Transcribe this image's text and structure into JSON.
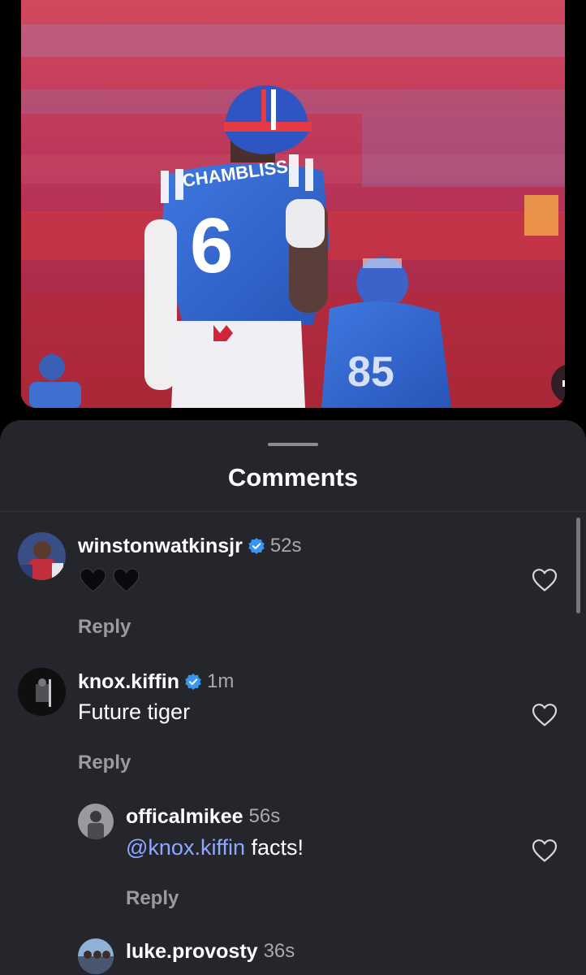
{
  "video": {
    "jersey_name": "CHAMBLISS",
    "jersey_number": "6",
    "second_player_number": "85",
    "sound_icon": "speaker-icon"
  },
  "sheet": {
    "title": "Comments"
  },
  "comments": [
    {
      "username": "winstonwatkinsjr",
      "verified": true,
      "time": "52s",
      "text": "",
      "emoji": [
        "black-heart",
        "black-heart"
      ],
      "reply_label": "Reply"
    },
    {
      "username": "knox.kiffin",
      "verified": true,
      "time": "1m",
      "text": "Future tiger",
      "reply_label": "Reply"
    },
    {
      "username": "officalmikee",
      "verified": false,
      "time": "56s",
      "mention": "@knox.kiffin",
      "text": " facts!",
      "reply_label": "Reply",
      "is_reply": true
    },
    {
      "username": "luke.provosty",
      "verified": false,
      "time": "36s",
      "is_reply": true
    }
  ],
  "colors": {
    "sheet_background": "#25262b",
    "verified_badge": "#3797f0",
    "mention": "#8ea8ff",
    "secondary_text": "#a8a9ae"
  }
}
